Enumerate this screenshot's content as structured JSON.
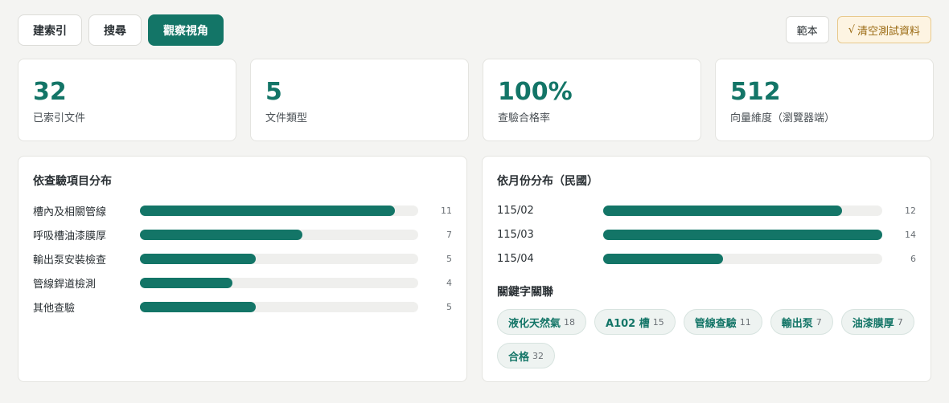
{
  "tabs": [
    {
      "label": "建索引",
      "active": false
    },
    {
      "label": "搜尋",
      "active": false
    },
    {
      "label": "觀察視角",
      "active": true
    }
  ],
  "actions": {
    "sample_label": "範本",
    "clear_check": "√",
    "clear_label": "清空測試資料"
  },
  "stats": [
    {
      "value": "32",
      "label": "已索引文件"
    },
    {
      "value": "5",
      "label": "文件類型"
    },
    {
      "value": "100%",
      "label": "查驗合格率"
    },
    {
      "value": "512",
      "label": "向量維度（瀏覽器端）"
    }
  ],
  "by_item": {
    "title": "依查驗項目分布",
    "max": 12,
    "rows": [
      {
        "label": "槽內及相關管線",
        "count": 11
      },
      {
        "label": "呼吸槽油漆膜厚",
        "count": 7
      },
      {
        "label": "輸出泵安裝檢查",
        "count": 5
      },
      {
        "label": "管線銲道檢測",
        "count": 4
      },
      {
        "label": "其他查驗",
        "count": 5
      }
    ]
  },
  "by_month": {
    "title": "依月份分布（民國）",
    "max": 14,
    "rows": [
      {
        "label": "115/02",
        "count": 12
      },
      {
        "label": "115/03",
        "count": 14
      },
      {
        "label": "115/04",
        "count": 6
      }
    ]
  },
  "keywords": {
    "title": "關鍵字關聯",
    "chips": [
      {
        "label": "液化天然氣",
        "count": 18
      },
      {
        "label": "A102 槽",
        "count": 15
      },
      {
        "label": "管線查驗",
        "count": 11
      },
      {
        "label": "輸出泵",
        "count": 7
      },
      {
        "label": "油漆膜厚",
        "count": 7
      },
      {
        "label": "合格",
        "count": 32
      }
    ]
  },
  "colors": {
    "accent": "#137567",
    "track": "#efefed"
  }
}
